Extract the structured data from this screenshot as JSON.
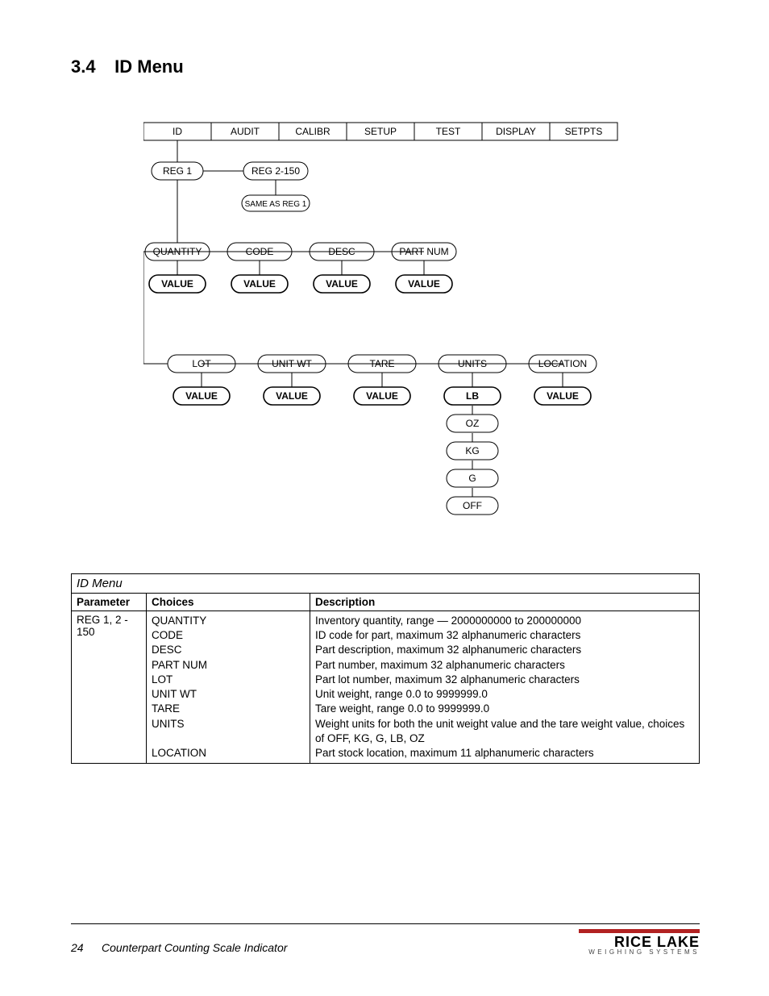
{
  "heading": {
    "number": "3.4",
    "title": "ID Menu"
  },
  "diagram": {
    "top_tabs": [
      "ID",
      "AUDIT",
      "CALIBR",
      "SETUP",
      "TEST",
      "DISPLAY",
      "SETPTS"
    ],
    "reg_row": {
      "reg1": "REG 1",
      "reg2": "REG 2-150",
      "same": "SAME AS REG 1"
    },
    "row1": {
      "items": [
        "QUANTITY",
        "CODE",
        "DESC",
        "PART NUM"
      ],
      "values": [
        "VALUE",
        "VALUE",
        "VALUE",
        "VALUE"
      ]
    },
    "row2": {
      "items": [
        "LOT",
        "UNIT WT",
        "TARE",
        "UNITS",
        "LOCATION"
      ],
      "values": [
        "VALUE",
        "VALUE",
        "VALUE",
        "LB",
        "VALUE"
      ],
      "units_options": [
        "OZ",
        "KG",
        "G",
        "OFF"
      ]
    }
  },
  "table": {
    "caption": "ID Menu",
    "headers": {
      "param": "Parameter",
      "choices": "Choices",
      "desc": "Description"
    },
    "param": "REG 1, 2 - 150",
    "choices": [
      "QUANTITY",
      "CODE",
      "DESC",
      "PART NUM",
      "LOT",
      "UNIT WT",
      "TARE",
      "UNITS",
      "LOCATION"
    ],
    "descriptions": [
      "Inventory quantity, range — 2000000000 to 200000000",
      "ID code for part, maximum 32 alphanumeric characters",
      "Part description, maximum 32 alphanumeric characters",
      "Part number, maximum 32 alphanumeric characters",
      "Part lot number, maximum 32 alphanumeric characters",
      "Unit weight, range 0.0 to 9999999.0",
      "Tare weight, range 0.0 to 9999999.0",
      "Weight units for both the unit weight value and the tare weight value, choices of OFF, KG, G, LB, OZ",
      "Part stock location, maximum 11 alphanumeric characters"
    ]
  },
  "footer": {
    "page": "24",
    "doc": "Counterpart Counting Scale Indicator",
    "logo": {
      "name": "RICE LAKE",
      "sub": "WEIGHING SYSTEMS"
    }
  }
}
